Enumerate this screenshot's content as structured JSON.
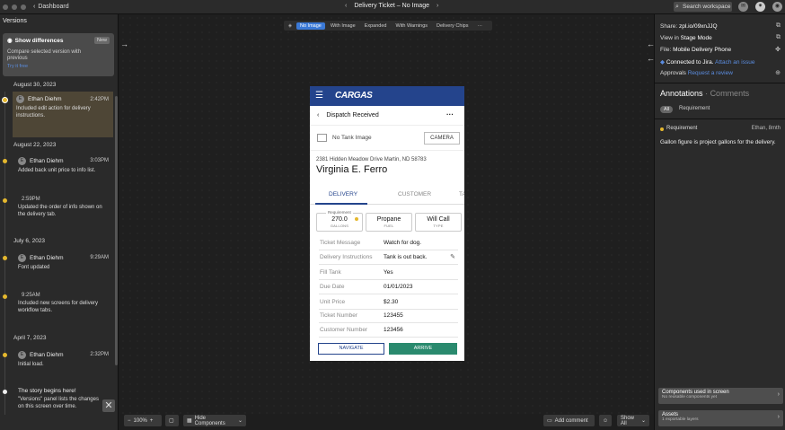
{
  "topbar": {
    "back_label": "Dashboard",
    "title": "Delivery Ticket – No Image",
    "search_placeholder": "Search workspace"
  },
  "left_panel": {
    "title": "Versions",
    "show_diff": {
      "title": "Show differences",
      "badge": "New",
      "desc": "Compare selected version with previous",
      "link": "Try it free"
    },
    "groups": [
      {
        "date": "August 30, 2023"
      },
      {
        "date": "August 22, 2023"
      },
      {
        "date": "July 6, 2023"
      },
      {
        "date": "April 7, 2023"
      }
    ],
    "entries": [
      {
        "name": "Ethan Diehm",
        "time": "2:42PM",
        "msg": "Included edit action for delivery instructions."
      },
      {
        "name": "Ethan Diehm",
        "time": "3:03PM",
        "msg": "Added back unit price to info list."
      },
      {
        "name": "",
        "time": "2:59PM",
        "msg": "Updated the order of info shown on the delivery tab."
      },
      {
        "name": "Ethan Diehm",
        "time": "9:29AM",
        "msg": "Font updated"
      },
      {
        "name": "",
        "time": "9:25AM",
        "msg": "Included new screens for delivery workflow tabs."
      },
      {
        "name": "Ethan Diehm",
        "time": "2:32PM",
        "msg": "Initial load."
      }
    ],
    "story": {
      "title": "The story begins here!",
      "desc": "\"Versions\" panel lists the changes on this screen over time."
    }
  },
  "view_tabs": [
    "No Image",
    "With Image",
    "Expanded",
    "With Warnings",
    "Delivery Chips",
    "···"
  ],
  "phone": {
    "logo": "CARGAS",
    "screen_title": "Dispatch Received",
    "no_image": "No Tank Image",
    "camera": "CAMERA",
    "address": "2381 Hidden Meadow Drive Martin, ND 58783",
    "customer": "Virginia E. Ferro",
    "tabs": [
      "DELIVERY",
      "CUSTOMER",
      "TA"
    ],
    "requirement_tag": "Requirement",
    "stats": [
      {
        "value": "270.0",
        "label": "GALLONS"
      },
      {
        "value": "Propane",
        "label": "FUEL"
      },
      {
        "value": "Will Call",
        "label": "TYPE"
      }
    ],
    "fields": [
      {
        "key": "Ticket Message",
        "value": "Watch for dog."
      },
      {
        "key": "Delivery Instructions",
        "value": "Tank is out back."
      },
      {
        "key": "Fill Tank",
        "value": "Yes"
      },
      {
        "key": "Due Date",
        "value": "01/01/2023"
      },
      {
        "key": "Unit Price",
        "value": "$2.30"
      },
      {
        "key": "Ticket Number",
        "value": "123455"
      },
      {
        "key": "Customer Number",
        "value": "123456"
      }
    ],
    "navigate": "NAVIGATE",
    "arrive": "ARRIVE"
  },
  "right_panel": {
    "share_label": "Share:",
    "share_value": "zpl.io/09xnJJQ",
    "view_in": "View in",
    "stage_mode": "Stage Mode",
    "file_label": "File:",
    "file_value": "Mobile Delivery Phone",
    "jira": "Connected to Jira.",
    "attach": "Attach an issue",
    "approvals": "Approvals",
    "request_review": "Request a review",
    "annotations": "Annotations",
    "comments": "Comments",
    "filter_all": "All",
    "filter_req": "Requirement",
    "ann_type": "Requirement",
    "ann_author": "Ethan, 8mth",
    "ann_msg": "Gallon figure is project gallons for the delivery.",
    "components_title": "Components used in screen",
    "components_sub": "No reusable components yet",
    "assets_title": "Assets",
    "assets_sub": "1 exportable layers"
  },
  "bottom": {
    "zoom": "100%",
    "hide_components": "Hide Components",
    "add_comment": "Add comment",
    "show_all": "Show All"
  }
}
